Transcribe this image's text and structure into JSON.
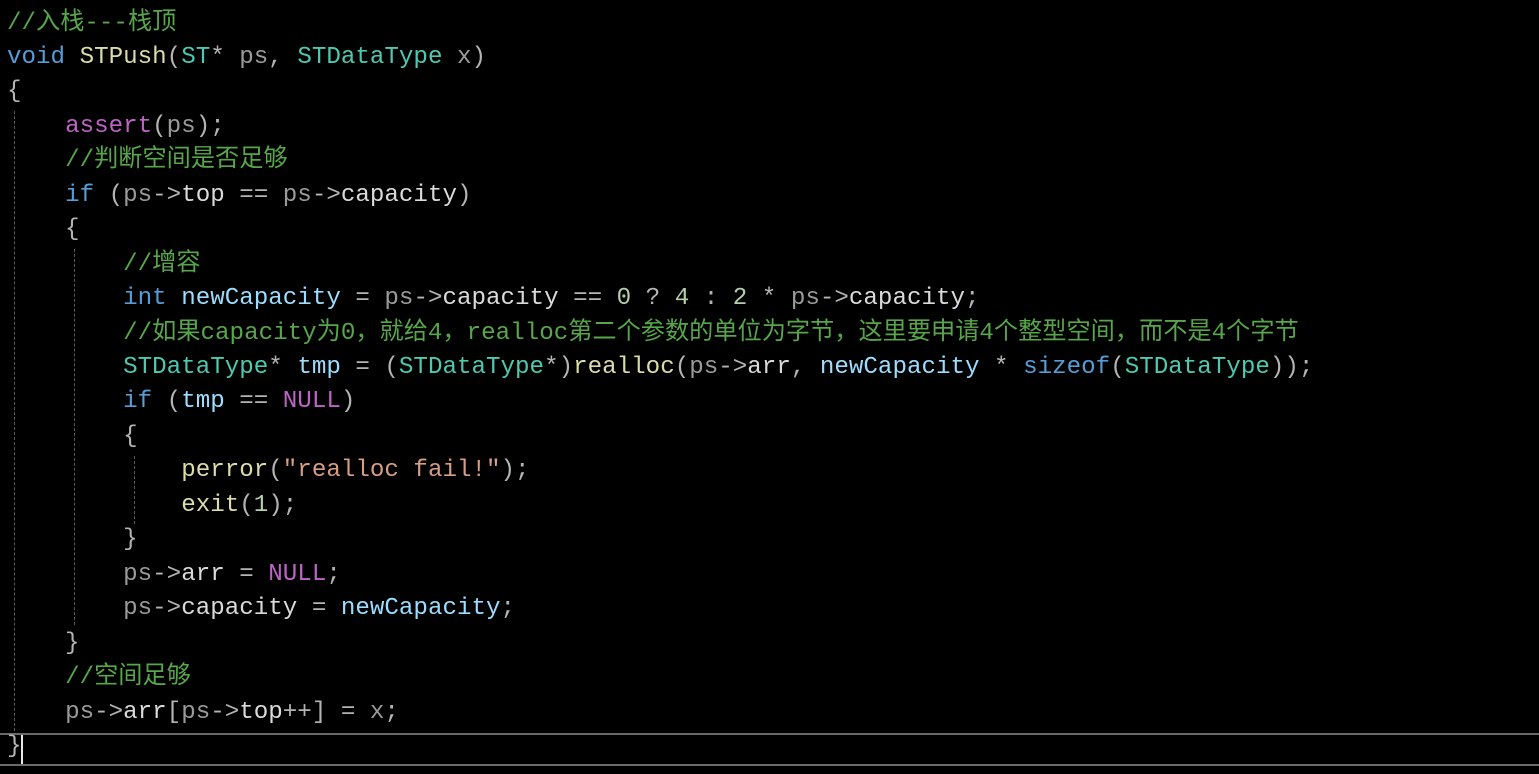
{
  "theme": {
    "background": "#000000",
    "colors": {
      "comment": "#57a64a",
      "keyword": "#569cd6",
      "function": "#dcdcaa",
      "type": "#4ec9b0",
      "param": "#9a9a9a",
      "local": "#9cdcfe",
      "member": "#dadada",
      "number": "#b5cea8",
      "string": "#d69d85",
      "macro": "#bd63c5",
      "plain": "#b4b4b4"
    }
  },
  "code": {
    "lines": [
      {
        "tokens": [
          {
            "t": "//入栈---栈顶",
            "c": "comment"
          }
        ]
      },
      {
        "tokens": [
          {
            "t": "void",
            "c": "keyword"
          },
          {
            "t": " ",
            "c": "plain"
          },
          {
            "t": "STPush",
            "c": "function"
          },
          {
            "t": "(",
            "c": "plain"
          },
          {
            "t": "ST",
            "c": "type"
          },
          {
            "t": "* ",
            "c": "plain"
          },
          {
            "t": "ps",
            "c": "param"
          },
          {
            "t": ", ",
            "c": "plain"
          },
          {
            "t": "STDataType",
            "c": "type"
          },
          {
            "t": " ",
            "c": "plain"
          },
          {
            "t": "x",
            "c": "param"
          },
          {
            "t": ")",
            "c": "plain"
          }
        ]
      },
      {
        "tokens": [
          {
            "t": "{",
            "c": "plain"
          }
        ]
      },
      {
        "tokens": [
          {
            "t": "    ",
            "c": "plain"
          },
          {
            "t": "assert",
            "c": "macro"
          },
          {
            "t": "(",
            "c": "plain"
          },
          {
            "t": "ps",
            "c": "param"
          },
          {
            "t": ");",
            "c": "plain"
          }
        ]
      },
      {
        "tokens": [
          {
            "t": "    ",
            "c": "plain"
          },
          {
            "t": "//判断空间是否足够",
            "c": "comment"
          }
        ]
      },
      {
        "tokens": [
          {
            "t": "    ",
            "c": "plain"
          },
          {
            "t": "if",
            "c": "keyword"
          },
          {
            "t": " (",
            "c": "plain"
          },
          {
            "t": "ps",
            "c": "param"
          },
          {
            "t": "->",
            "c": "plain"
          },
          {
            "t": "top",
            "c": "member"
          },
          {
            "t": " == ",
            "c": "plain"
          },
          {
            "t": "ps",
            "c": "param"
          },
          {
            "t": "->",
            "c": "plain"
          },
          {
            "t": "capacity",
            "c": "member"
          },
          {
            "t": ")",
            "c": "plain"
          }
        ]
      },
      {
        "tokens": [
          {
            "t": "    {",
            "c": "plain"
          }
        ]
      },
      {
        "tokens": [
          {
            "t": "        ",
            "c": "plain"
          },
          {
            "t": "//增容",
            "c": "comment"
          }
        ]
      },
      {
        "tokens": [
          {
            "t": "        ",
            "c": "plain"
          },
          {
            "t": "int",
            "c": "keyword"
          },
          {
            "t": " ",
            "c": "plain"
          },
          {
            "t": "newCapacity",
            "c": "local"
          },
          {
            "t": " = ",
            "c": "plain"
          },
          {
            "t": "ps",
            "c": "param"
          },
          {
            "t": "->",
            "c": "plain"
          },
          {
            "t": "capacity",
            "c": "member"
          },
          {
            "t": " == ",
            "c": "plain"
          },
          {
            "t": "0",
            "c": "number"
          },
          {
            "t": " ? ",
            "c": "plain"
          },
          {
            "t": "4",
            "c": "number"
          },
          {
            "t": " : ",
            "c": "plain"
          },
          {
            "t": "2",
            "c": "number"
          },
          {
            "t": " * ",
            "c": "plain"
          },
          {
            "t": "ps",
            "c": "param"
          },
          {
            "t": "->",
            "c": "plain"
          },
          {
            "t": "capacity",
            "c": "member"
          },
          {
            "t": ";",
            "c": "plain"
          }
        ]
      },
      {
        "tokens": [
          {
            "t": "        ",
            "c": "plain"
          },
          {
            "t": "//如果capacity为0，就给4，realloc第二个参数的单位为字节，这里要申请4个整型空间，而不是4个字节",
            "c": "comment"
          }
        ]
      },
      {
        "tokens": [
          {
            "t": "        ",
            "c": "plain"
          },
          {
            "t": "STDataType",
            "c": "type"
          },
          {
            "t": "* ",
            "c": "plain"
          },
          {
            "t": "tmp",
            "c": "local"
          },
          {
            "t": " = (",
            "c": "plain"
          },
          {
            "t": "STDataType",
            "c": "type"
          },
          {
            "t": "*)",
            "c": "plain"
          },
          {
            "t": "realloc",
            "c": "function"
          },
          {
            "t": "(",
            "c": "plain"
          },
          {
            "t": "ps",
            "c": "param"
          },
          {
            "t": "->",
            "c": "plain"
          },
          {
            "t": "arr",
            "c": "member"
          },
          {
            "t": ", ",
            "c": "plain"
          },
          {
            "t": "newCapacity",
            "c": "local"
          },
          {
            "t": " * ",
            "c": "plain"
          },
          {
            "t": "sizeof",
            "c": "keyword"
          },
          {
            "t": "(",
            "c": "plain"
          },
          {
            "t": "STDataType",
            "c": "type"
          },
          {
            "t": "));",
            "c": "plain"
          }
        ]
      },
      {
        "tokens": [
          {
            "t": "        ",
            "c": "plain"
          },
          {
            "t": "if",
            "c": "keyword"
          },
          {
            "t": " (",
            "c": "plain"
          },
          {
            "t": "tmp",
            "c": "local"
          },
          {
            "t": " == ",
            "c": "plain"
          },
          {
            "t": "NULL",
            "c": "macro"
          },
          {
            "t": ")",
            "c": "plain"
          }
        ]
      },
      {
        "tokens": [
          {
            "t": "        {",
            "c": "plain"
          }
        ]
      },
      {
        "tokens": [
          {
            "t": "            ",
            "c": "plain"
          },
          {
            "t": "perror",
            "c": "function"
          },
          {
            "t": "(",
            "c": "plain"
          },
          {
            "t": "\"realloc fail!\"",
            "c": "string"
          },
          {
            "t": ");",
            "c": "plain"
          }
        ]
      },
      {
        "tokens": [
          {
            "t": "            ",
            "c": "plain"
          },
          {
            "t": "exit",
            "c": "function"
          },
          {
            "t": "(",
            "c": "plain"
          },
          {
            "t": "1",
            "c": "number"
          },
          {
            "t": ");",
            "c": "plain"
          }
        ]
      },
      {
        "tokens": [
          {
            "t": "        }",
            "c": "plain"
          }
        ]
      },
      {
        "tokens": [
          {
            "t": "        ",
            "c": "plain"
          },
          {
            "t": "ps",
            "c": "param"
          },
          {
            "t": "->",
            "c": "plain"
          },
          {
            "t": "arr",
            "c": "member"
          },
          {
            "t": " = ",
            "c": "plain"
          },
          {
            "t": "NULL",
            "c": "macro"
          },
          {
            "t": ";",
            "c": "plain"
          }
        ]
      },
      {
        "tokens": [
          {
            "t": "        ",
            "c": "plain"
          },
          {
            "t": "ps",
            "c": "param"
          },
          {
            "t": "->",
            "c": "plain"
          },
          {
            "t": "capacity",
            "c": "member"
          },
          {
            "t": " = ",
            "c": "plain"
          },
          {
            "t": "newCapacity",
            "c": "local"
          },
          {
            "t": ";",
            "c": "plain"
          }
        ]
      },
      {
        "tokens": [
          {
            "t": "    }",
            "c": "plain"
          }
        ]
      },
      {
        "tokens": [
          {
            "t": "    ",
            "c": "plain"
          },
          {
            "t": "//空间足够",
            "c": "comment"
          }
        ]
      },
      {
        "tokens": [
          {
            "t": "    ",
            "c": "plain"
          },
          {
            "t": "ps",
            "c": "param"
          },
          {
            "t": "->",
            "c": "plain"
          },
          {
            "t": "arr",
            "c": "member"
          },
          {
            "t": "[",
            "c": "plain"
          },
          {
            "t": "ps",
            "c": "param"
          },
          {
            "t": "->",
            "c": "plain"
          },
          {
            "t": "top",
            "c": "member"
          },
          {
            "t": "++] = ",
            "c": "plain"
          },
          {
            "t": "x",
            "c": "param"
          },
          {
            "t": ";",
            "c": "plain"
          }
        ]
      },
      {
        "tokens": [
          {
            "t": "}",
            "c": "plain"
          }
        ]
      }
    ]
  }
}
